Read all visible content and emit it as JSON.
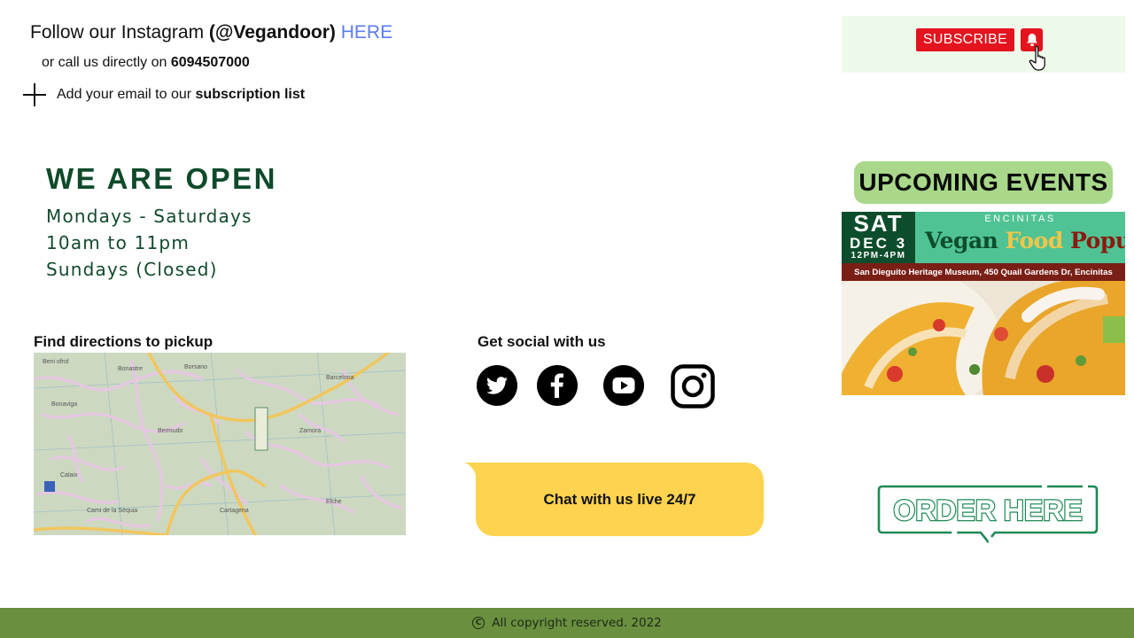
{
  "contact": {
    "follow_prefix": "Follow our Instagram ",
    "instagram_handle": "(@Vegandoor)",
    "here_link": "HERE",
    "call_prefix": "or call us directly on ",
    "phone": "6094507000",
    "email_prefix": "Add your email to our ",
    "email_bold": "subscription list"
  },
  "hours": {
    "title": "WE ARE OPEN",
    "days": "Mondays - Saturdays",
    "time": "10am to 11pm",
    "closed": "Sundays (Closed)"
  },
  "directions": {
    "label": "Find directions to pickup"
  },
  "social": {
    "label": "Get social with us",
    "icons": [
      "twitter-icon",
      "facebook-icon",
      "youtube-icon",
      "instagram-icon"
    ]
  },
  "chat": {
    "label": "Chat with us live 24/7",
    "color": "#fdd34f"
  },
  "subscribe": {
    "label": "SUBSCRIBE",
    "color": "#e3141e"
  },
  "events": {
    "title": "UPCOMING EVENTS",
    "poster": {
      "day": "SAT",
      "date": "DEC 3",
      "time": "12PM-4PM",
      "city": "ENCINITAS",
      "name_1": "Vegan",
      "name_2": "Food",
      "name_3": "Popup",
      "address": "San Dieguito Heritage Museum, 450 Quail Gardens Dr, Encinitas"
    }
  },
  "order": {
    "label": "ORDER HERE",
    "color": "#1e8a55"
  },
  "footer": {
    "copyright": "All copyright reserved. 2022",
    "color": "#6a8f3f"
  }
}
